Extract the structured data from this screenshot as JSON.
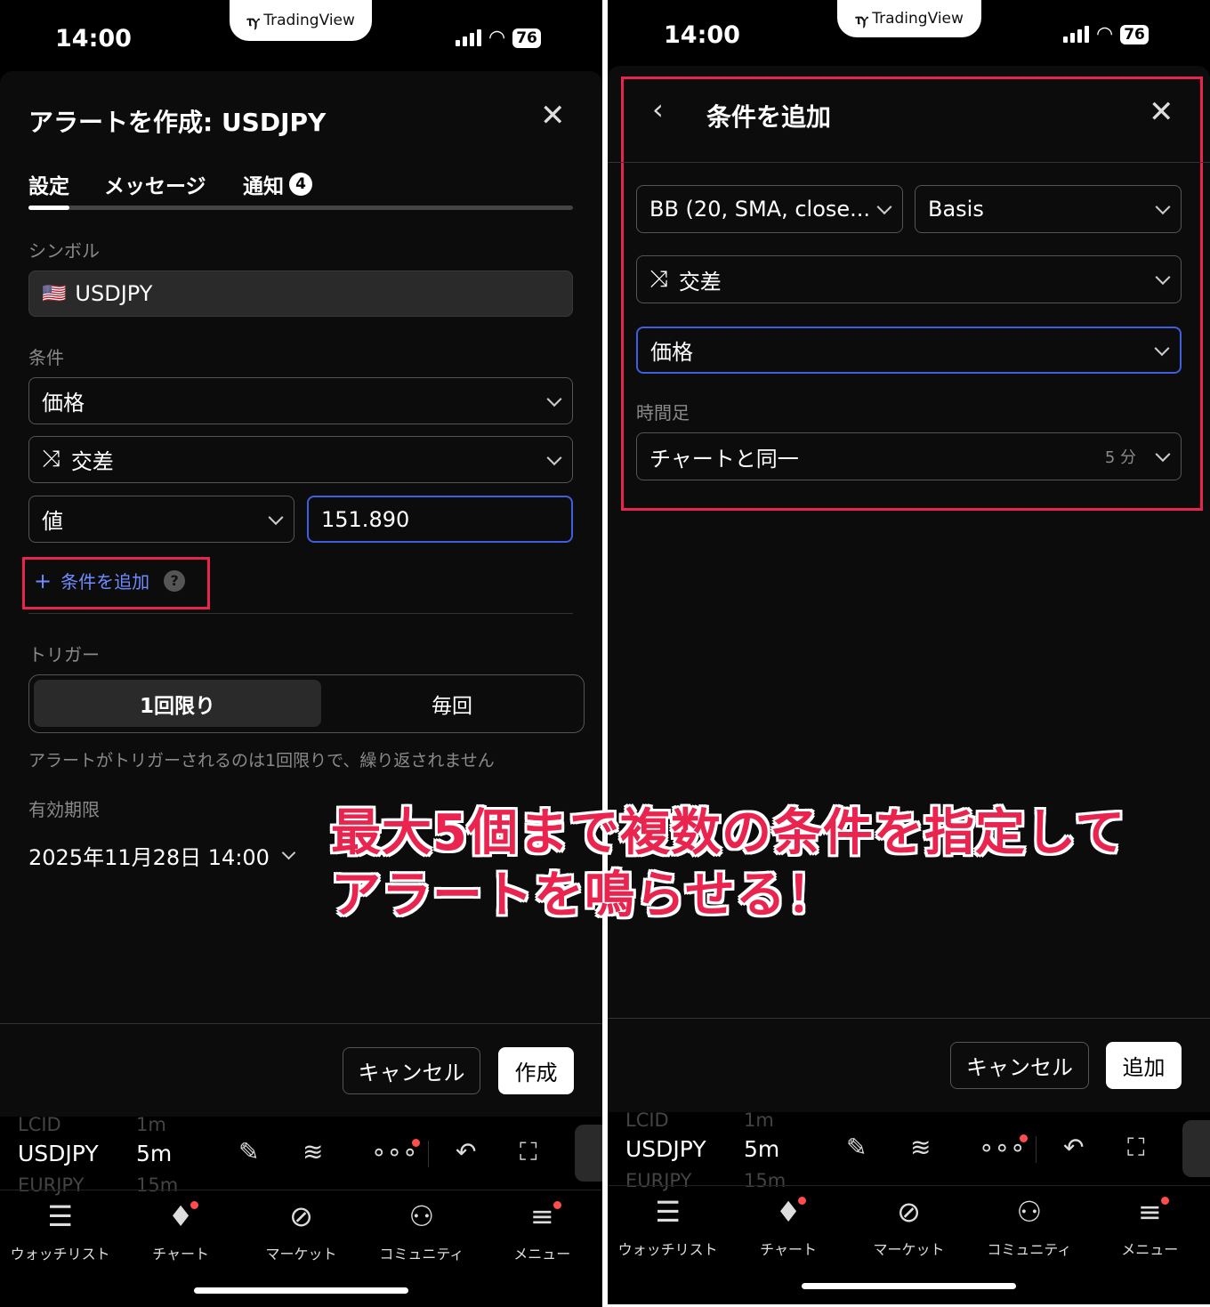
{
  "left": {
    "brand": "TradingView",
    "time": "14:00",
    "battery": "76",
    "title": "アラートを作成: USDJPY",
    "tabs": [
      {
        "label": "設定"
      },
      {
        "label": "メッセージ"
      },
      {
        "label": "通知",
        "badge": "4"
      }
    ],
    "symbol_label": "シンボル",
    "symbol_value": "USDJPY",
    "condition_label": "条件",
    "condition_source": "価格",
    "condition_operator": "交差",
    "value_type": "値",
    "value": "151.890",
    "add_condition": "条件を追加",
    "help": "?",
    "trigger_label": "トリガー",
    "trigger_options": [
      "1回限り",
      "毎回"
    ],
    "trigger_note": "アラートがトリガーされるのは1回限りで、繰り返されません",
    "expiry_label": "有効期限",
    "expiry_value": "2025年11月28日 14:00",
    "cancel": "キャンセル",
    "create": "作成"
  },
  "right": {
    "brand": "TradingView",
    "time": "14:00",
    "battery": "76",
    "title": "条件を追加",
    "indicator": "BB (20, SMA, close...",
    "line": "Basis",
    "operator": "交差",
    "source": "価格",
    "timeframe_label": "時間足",
    "timeframe_value": "チャートと同一",
    "timeframe_hint": "5 分",
    "cancel": "キャンセル",
    "add": "追加"
  },
  "bottom": {
    "ghost_top": "LCID",
    "ghost_top_tf": "1m",
    "symbol": "USDJPY",
    "interval": "5m",
    "ghost_bottom": "EURJPY",
    "ghost_bottom_tf": "15m",
    "tabs": [
      "ウォッチリスト",
      "チャート",
      "マーケット",
      "コミュニティ",
      "メニュー"
    ]
  },
  "annotation": {
    "line1": "最大5個まで複数の条件を指定して",
    "line2": "アラートを鳴らせる！"
  },
  "colors": {
    "accent_blue": "#3f5ee0",
    "highlight_red": "#e8244f",
    "link_blue": "#6f8cff"
  }
}
